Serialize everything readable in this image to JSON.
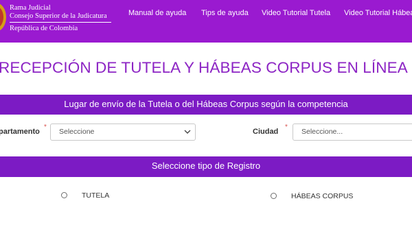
{
  "header": {
    "brand": {
      "line1": "Rama Judicial",
      "line2": "Consejo Superior de la Judicatura",
      "line3": "República de Colombia"
    },
    "nav": [
      {
        "label": "Manual de ayuda"
      },
      {
        "label": "Tips de ayuda"
      },
      {
        "label": "Video Tutorial Tutela"
      },
      {
        "label": "Video Tutorial Hábeas"
      }
    ],
    "colors": {
      "bar": "#9a1ad0",
      "accent": "#8c24c4",
      "band": "#7c1bc4"
    }
  },
  "page": {
    "title": "RECEPCIÓN DE TUTELA Y HÁBEAS CORPUS EN LÍNEA"
  },
  "location_section": {
    "heading": "Lugar de envío de la Tutela o del Hábeas Corpus según la competencia",
    "departamento": {
      "label": "partamento",
      "required_mark": "*",
      "value": "Seleccione"
    },
    "ciudad": {
      "label": "Ciudad",
      "required_mark": "*",
      "value": "Seleccione..."
    }
  },
  "registro_section": {
    "heading": "Seleccione tipo de Registro",
    "options": [
      {
        "label": "TUTELA",
        "selected": false
      },
      {
        "label": "HÁBEAS CORPUS",
        "selected": false
      }
    ]
  }
}
